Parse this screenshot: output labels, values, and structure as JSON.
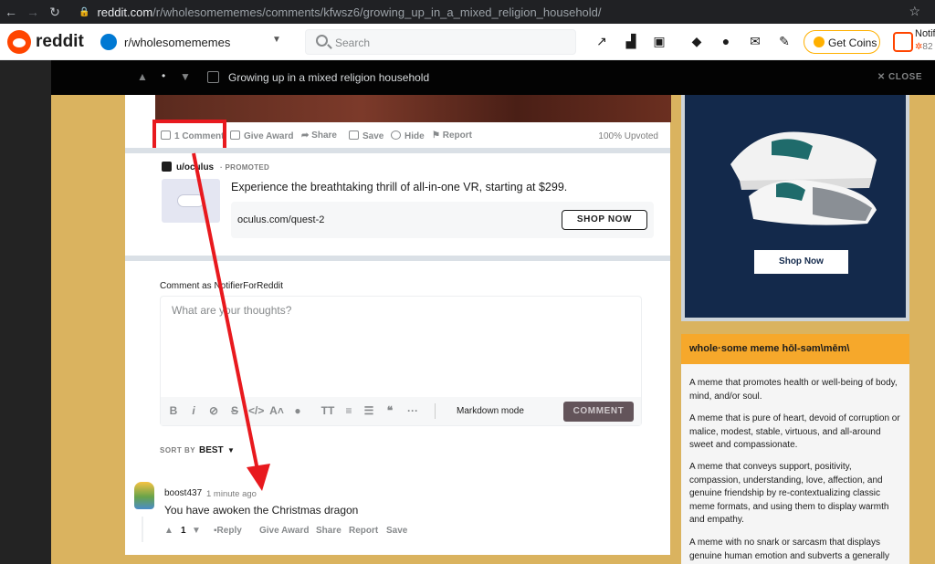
{
  "browser": {
    "url_host": "reddit.com",
    "url_path": "/r/wholesomememes/comments/kfwsz6/growing_up_in_a_mixed_religion_household/"
  },
  "header": {
    "wordmark": "reddit",
    "subreddit": "r/wholesomememes",
    "search_placeholder": "Search",
    "get_coins": "Get Coins",
    "user_name": "Notif",
    "user_karma": "82"
  },
  "post_bar": {
    "title": "Growing up in a mixed religion household",
    "dot": "•",
    "close": "CLOSE"
  },
  "post": {
    "actions": {
      "comments": "1 Comment",
      "give_award": "Give Award",
      "share": "Share",
      "save": "Save",
      "hide": "Hide",
      "report": "Report"
    },
    "upvoted": "100% Upvoted"
  },
  "ad": {
    "user": "u/oculus",
    "promoted": "· PROMOTED",
    "headline": "Experience the breathtaking thrill of all-in-one VR, starting at $299.",
    "link": "oculus.com/quest-2",
    "cta": "SHOP NOW"
  },
  "comment_box": {
    "comment_as": "Comment as NotifierForReddit",
    "placeholder": "What are your thoughts?",
    "markdown_mode": "Markdown mode",
    "submit": "COMMENT"
  },
  "sort": {
    "label": "SORT BY",
    "value": "BEST"
  },
  "comments": [
    {
      "user": "boost437",
      "time": "1 minute ago",
      "body": "You have awoken the Christmas dragon",
      "score": "1",
      "actions": {
        "reply": "Reply",
        "give_award": "Give Award",
        "share": "Share",
        "report": "Report",
        "save": "Save"
      }
    }
  ],
  "sidebar": {
    "ad_cta": "Shop Now",
    "widget_title": "whole·some meme hōl-səm\\mēm\\",
    "widget_paragraphs": [
      "A meme that promotes health or well-being of body, mind, and/or soul.",
      "A meme that is pure of heart, devoid of corruption or malice, modest, stable, virtuous, and all-around sweet and compassionate.",
      "A meme that conveys support, positivity, compassion, understanding, love, affection, and genuine friendship by re-contextualizing classic meme formats, and using them to display warmth and empathy.",
      "A meme with no snark or sarcasm that displays genuine human emotion and subverts a generally"
    ]
  },
  "colors": {
    "brand": "#ff4500",
    "annotation_red": "#e8191e",
    "widget_accent": "#f6a82b",
    "background": "#dab35f"
  }
}
